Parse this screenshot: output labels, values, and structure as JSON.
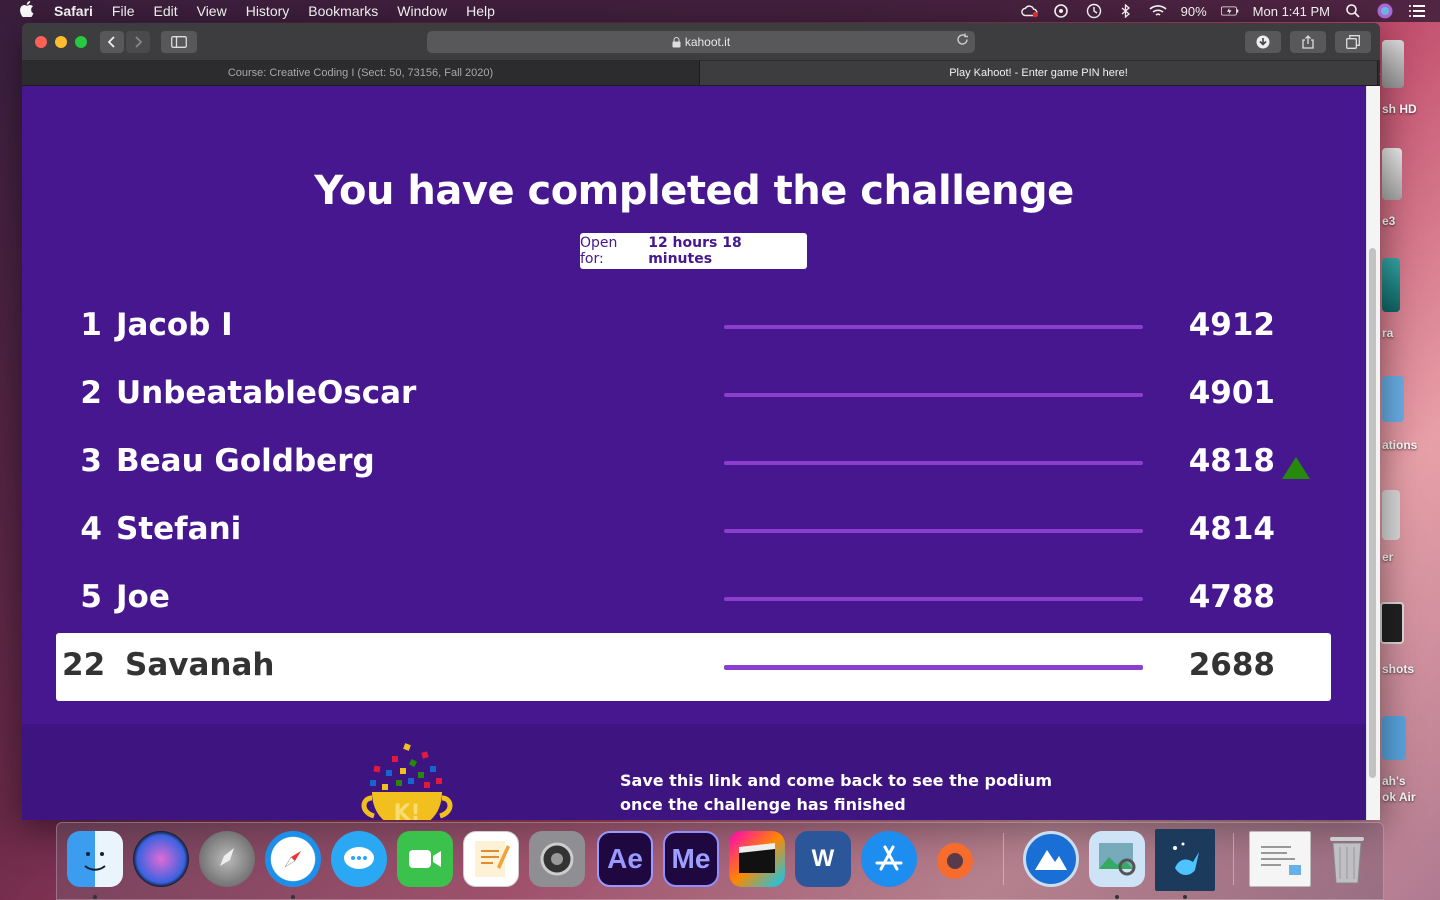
{
  "menubar": {
    "app": "Safari",
    "items": [
      "File",
      "Edit",
      "View",
      "History",
      "Bookmarks",
      "Window",
      "Help"
    ],
    "battery": "90%",
    "clock": "Mon 1:41 PM"
  },
  "desktop_labels": [
    "sh HD",
    "e3",
    "ra",
    "ations",
    "er",
    "shots",
    "ah's",
    "ok Air"
  ],
  "browser": {
    "url": "kahoot.it",
    "tabs": [
      {
        "label": "Course: Creative Coding I (Sect: 50, 73156, Fall 2020)",
        "active": false
      },
      {
        "label": "Play Kahoot! - Enter game PIN here!",
        "active": true
      }
    ],
    "new_tab": "+"
  },
  "kahoot": {
    "title": "You have completed the challenge",
    "open_for_label": "Open for:",
    "open_for_value": "12 hours 18 minutes",
    "leaderboard": [
      {
        "rank": "1",
        "name": "Jacob I",
        "score": "4912",
        "trend": ""
      },
      {
        "rank": "2",
        "name": "UnbeatableOscar",
        "score": "4901",
        "trend": ""
      },
      {
        "rank": "3",
        "name": "Beau Goldberg",
        "score": "4818",
        "trend": "up"
      },
      {
        "rank": "4",
        "name": "Stefani",
        "score": "4814",
        "trend": ""
      },
      {
        "rank": "5",
        "name": "Joe",
        "score": "4788",
        "trend": ""
      },
      {
        "rank": "22",
        "name": "Savanah",
        "score": "2688",
        "trend": ""
      }
    ],
    "save_line1": "Save this link and come back to see the podium",
    "save_line2": "once the challenge has finished",
    "trophy_letter": "K!"
  },
  "dock": {
    "apps": [
      "Finder",
      "Siri",
      "Launchpad",
      "Safari",
      "Messages",
      "FaceTime",
      "Pages",
      "System Preferences",
      "After Effects",
      "Media Encoder",
      "Final Cut Pro",
      "Word",
      "App Store",
      "Origin",
      "Mojave",
      "Preview",
      "Kahoot",
      "Documents",
      "Trash"
    ],
    "ae_label": "Ae",
    "me_label": "Me",
    "word_label": "W"
  },
  "colors": {
    "kahoot_purple": "#46178f",
    "bar_purple": "#8a3fcf",
    "trend_green": "#26890c"
  }
}
